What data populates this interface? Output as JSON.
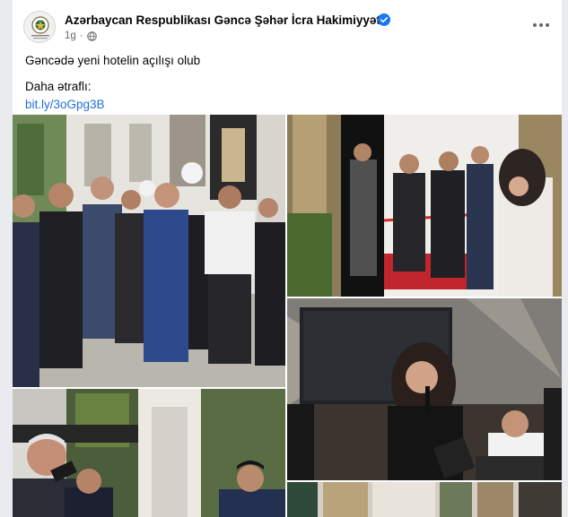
{
  "post": {
    "page_name": "Azərbaycan Respublikası Gəncə Şəhər İcra Hakimiyyəti",
    "time": "1g",
    "separator": "·",
    "privacy_icon": "globe-icon",
    "verified_icon": "verified-badge-icon",
    "more_icon": "more-options-icon",
    "headline": "Gəncədə yeni hotelin açılışı olub",
    "more_label": "Daha ətraflı:",
    "link_text": "bit.ly/3oGpg3B"
  },
  "photos": [
    {
      "name": "photo-officials-outside-hotel"
    },
    {
      "name": "photo-ribbon-cutting"
    },
    {
      "name": "photo-singer-performing"
    },
    {
      "name": "photo-speaker-microphone"
    },
    {
      "name": "photo-interior"
    }
  ],
  "colors": {
    "link": "#216fdb",
    "verified": "#1877f2",
    "carpet": "#c0262b"
  }
}
